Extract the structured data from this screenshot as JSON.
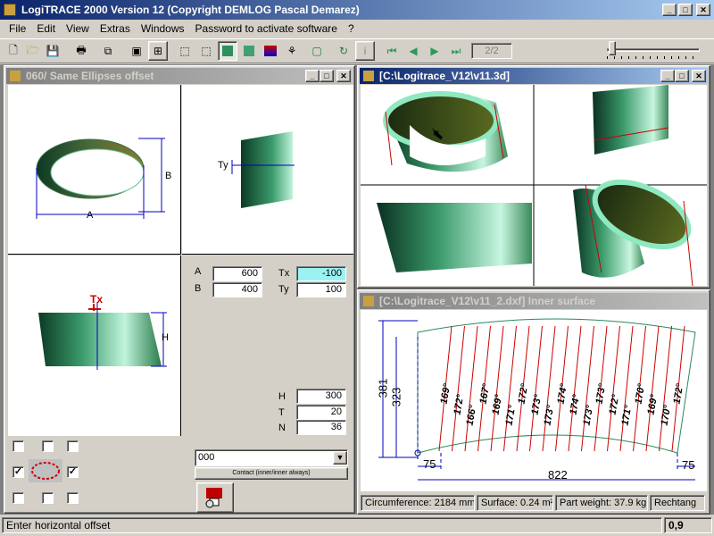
{
  "app": {
    "title": "LogiTRACE 2000  Version 12  (Copyright DEMLOG Pascal Demarez)"
  },
  "menu": [
    "File",
    "Edit",
    "View",
    "Extras",
    "Windows",
    "Password to activate software",
    "?"
  ],
  "toolbar": {
    "page": "2/2"
  },
  "win1": {
    "title": "060/ Same Ellipses offset",
    "labels": {
      "a_dim": "A",
      "b_dim": "B",
      "ty": "Ty",
      "tx": "Tx",
      "h_dim": "H"
    },
    "params": {
      "a_label": "A",
      "a_value": "600",
      "b_label": "B",
      "b_value": "400",
      "tx_label": "Tx",
      "tx_value": "-100",
      "ty_label": "Ty",
      "ty_value": "100",
      "h_label": "H",
      "h_value": "300",
      "t_label": "T",
      "t_value": "20",
      "n_label": "N",
      "n_value": "36"
    },
    "combo_value": "000",
    "contact_label": "Contact (inner/inner always)",
    "checks": [
      false,
      false,
      false,
      true,
      true,
      false,
      false,
      false
    ]
  },
  "win2": {
    "title": "[C:\\Logitrace_V12\\v11.3d]"
  },
  "win3": {
    "title": "[C:\\Logitrace_V12\\v11_2.dxf]  Inner surface",
    "dims": {
      "h1": "381",
      "h2": "323",
      "w_left": "75",
      "w_total": "822",
      "w_right": "75"
    },
    "angles": [
      "169°",
      "172°",
      "166°",
      "167°",
      "169°",
      "171°",
      "172°",
      "173°",
      "173°",
      "174°",
      "174°",
      "173°",
      "173°",
      "172°",
      "171°",
      "170°",
      "169°",
      "170°",
      "172°"
    ],
    "status": [
      "Circumference: 2184 mm",
      "Surface: 0.24 m²",
      "Part weight: 37.9 kg",
      "Rechtang"
    ]
  },
  "statusbar": {
    "message": "Enter horizontal offset",
    "coord": "0,9"
  },
  "colors": {
    "title_active": "#0a246a",
    "title_inactive": "#808080",
    "highlight_field": "#9bf2f2",
    "cut_line": "#cc0000",
    "ring": "#5fd6a0"
  }
}
